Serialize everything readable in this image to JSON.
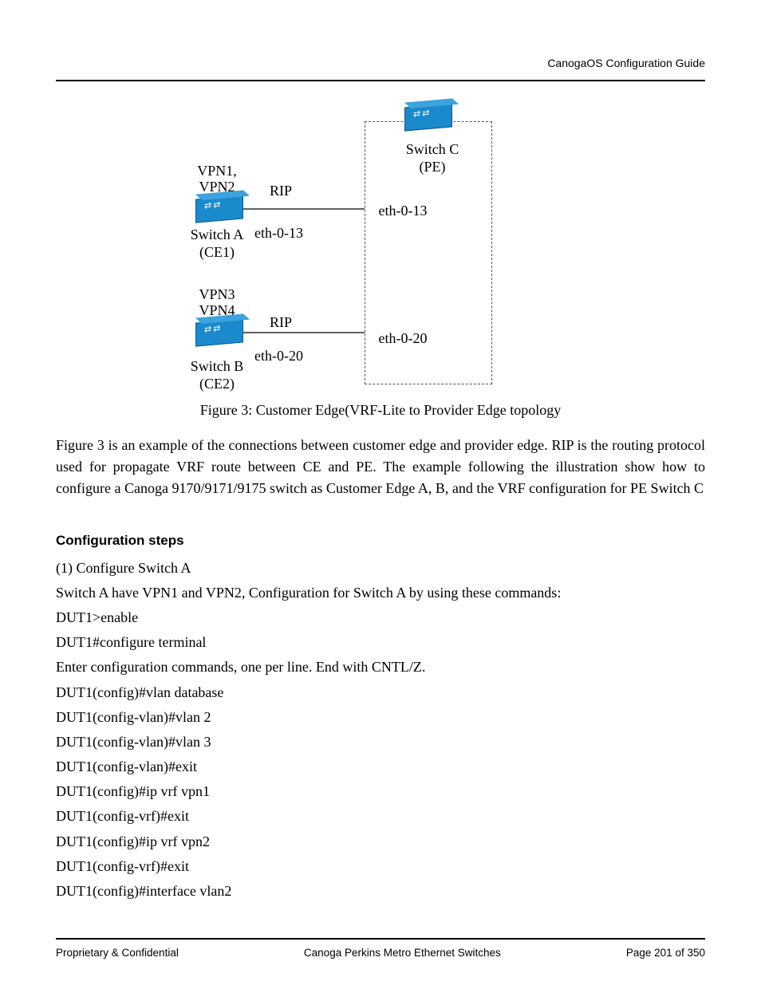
{
  "header": {
    "right": "CanogaOS Configuration Guide"
  },
  "diagram": {
    "switchA": {
      "vpn_line1": "VPN1,",
      "vpn_line2": "VPN2",
      "rip": "RIP",
      "name": "Switch A",
      "role": "(CE1)",
      "port": "eth-0-13"
    },
    "switchB": {
      "vpn_line1": "VPN3",
      "vpn_line2": "VPN4",
      "rip": "RIP",
      "name": "Switch B",
      "role": "(CE2)",
      "port": "eth-0-20"
    },
    "switchC": {
      "name": "Switch C",
      "role": "(PE)",
      "port1": "eth-0-13",
      "port2": "eth-0-20"
    }
  },
  "caption": "Figure 3: Customer Edge(VRF-Lite to Provider Edge topology",
  "paragraph": "Figure 3 is an example of the connections between customer edge and provider edge. RIP is the routing protocol used for propagate VRF route between CE and PE. The example following the illustration show how to configure a Canoga 9170/9171/9175 switch as Customer Edge A, B, and the VRF configuration for PE Switch C",
  "sectionHeading": "Configuration steps",
  "step1_title": "(1) Configure Switch A",
  "step1_desc": "Switch A have VPN1 and VPN2, Configuration for Switch A by using these commands:",
  "commands": [
    "DUT1>enable",
    "DUT1#configure terminal",
    "Enter configuration commands, one per line.    End with CNTL/Z.",
    "DUT1(config)#vlan database",
    "DUT1(config-vlan)#vlan 2",
    "DUT1(config-vlan)#vlan 3",
    "DUT1(config-vlan)#exit",
    "DUT1(config)#ip vrf vpn1",
    "DUT1(config-vrf)#exit",
    "DUT1(config)#ip vrf vpn2",
    "DUT1(config-vrf)#exit",
    "DUT1(config)#interface vlan2"
  ],
  "footer": {
    "left": "Proprietary & Confidential",
    "center": "Canoga Perkins Metro Ethernet Switches",
    "right": "Page 201 of 350"
  }
}
